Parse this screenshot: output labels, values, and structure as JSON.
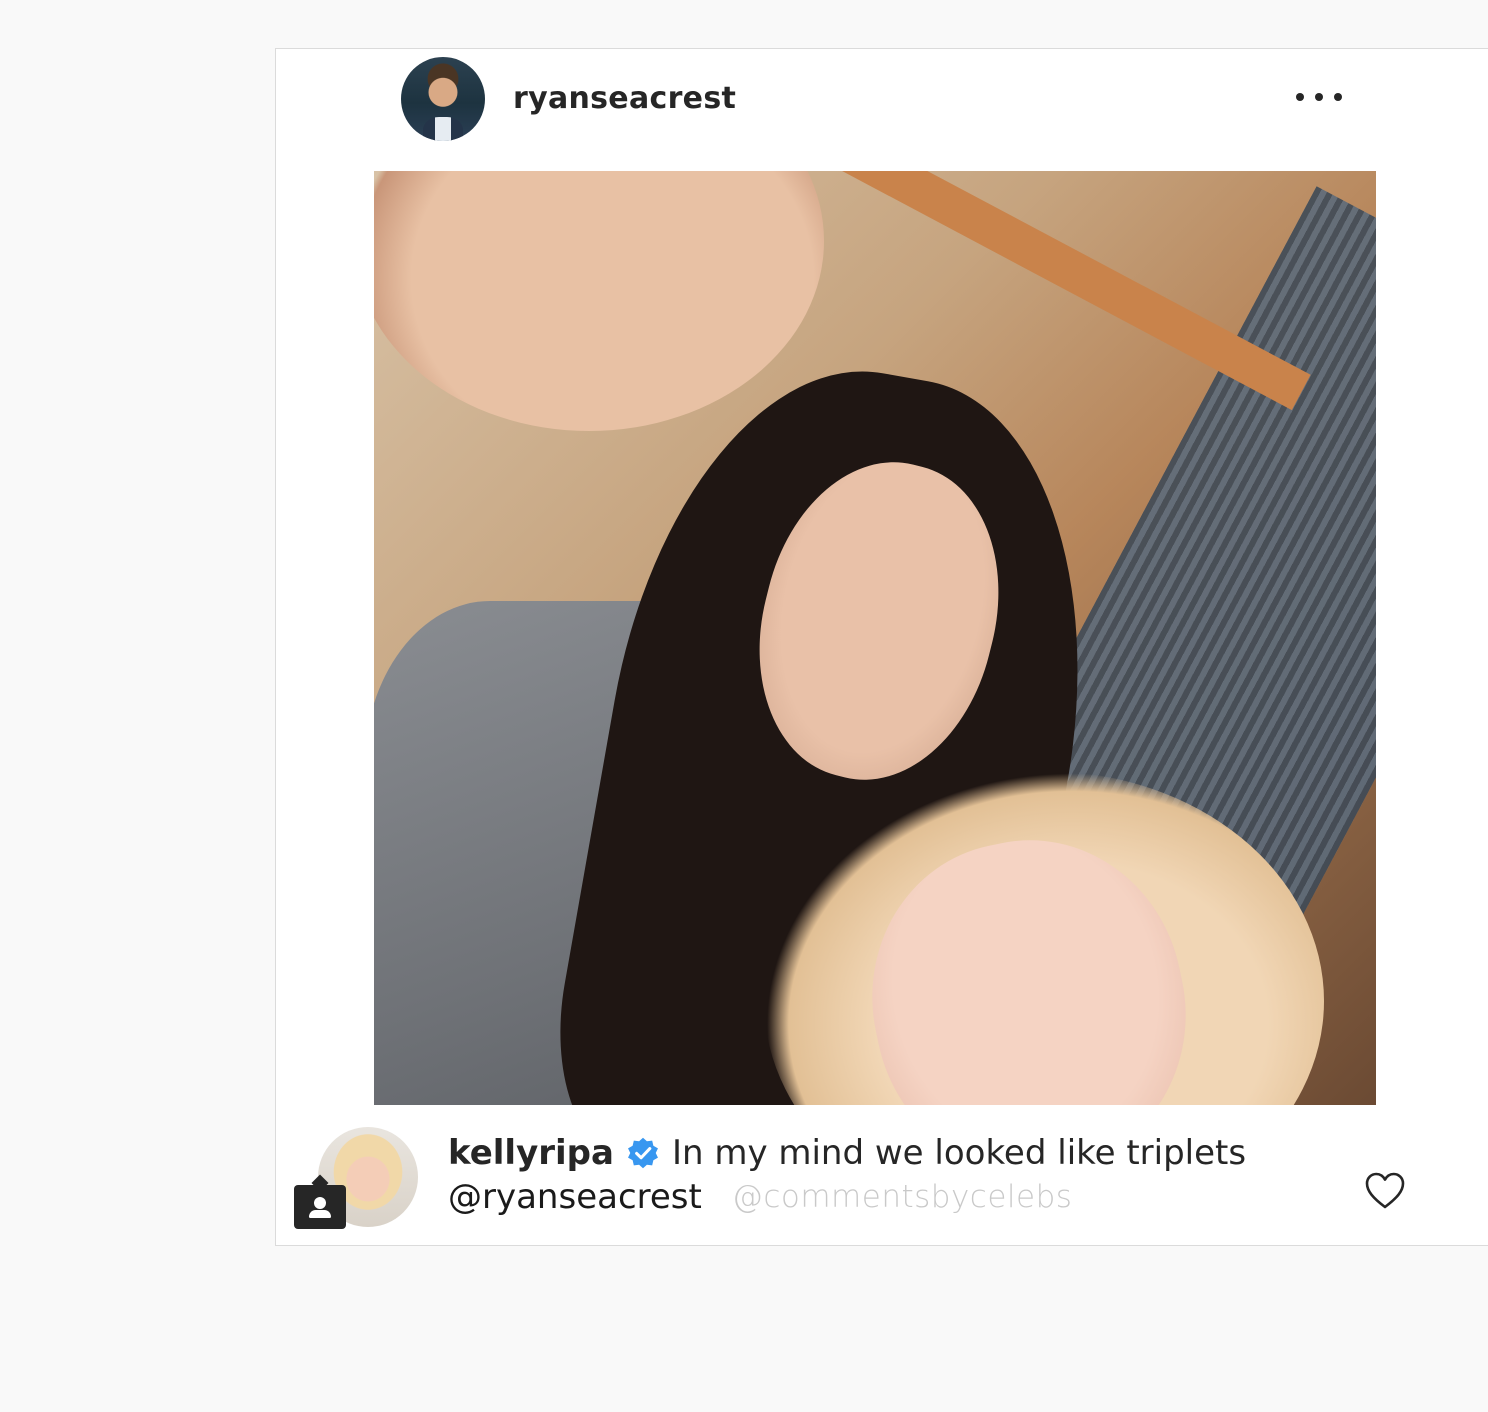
{
  "post": {
    "author": {
      "username": "ryanseacrest"
    },
    "menu_icon": "more-horizontal-icon"
  },
  "comment": {
    "username": "kellyripa",
    "verified_icon": "verified-badge-icon",
    "text": "In my mind we looked like triplets",
    "mention": "@ryanseacrest",
    "watermark": "@commentsbycelebs",
    "tag_icon": "person-tag-icon",
    "like_icon": "heart-outline-icon"
  },
  "colors": {
    "background": "#f9f9f9",
    "card": "#ffffff",
    "border": "#dbdbdb",
    "text": "#262626",
    "verified": "#3897f0",
    "watermark": "#c9c9c9"
  }
}
